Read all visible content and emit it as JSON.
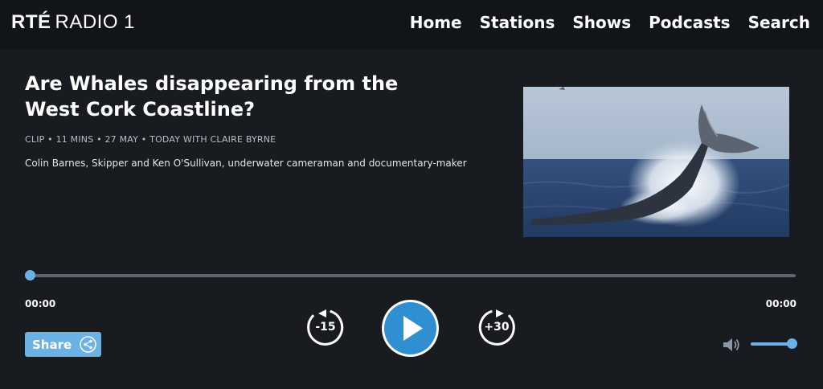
{
  "header": {
    "logo_brand": "RTÉ",
    "logo_station": "RADIO 1",
    "nav": [
      {
        "label": "Home"
      },
      {
        "label": "Stations"
      },
      {
        "label": "Shows"
      },
      {
        "label": "Podcasts"
      },
      {
        "label": "Search"
      }
    ]
  },
  "episode": {
    "title": "Are Whales disappearing from the West Cork Coastline?",
    "meta": "CLIP • 11 MINS • 27 MAY • TODAY WITH CLAIRE BYRNE",
    "description": "Colin Barnes, Skipper and Ken O'Sullivan, underwater cameraman and documentary-maker",
    "image_subject": "humpback whale tail breaching from sea"
  },
  "player": {
    "progress": 0,
    "elapsed": "00:00",
    "duration": "00:00",
    "skip_back_label": "-15",
    "skip_forward_label": "+30",
    "play_icon": "play-icon",
    "share_label": "Share",
    "share_icon": "share-icon",
    "volume_icon": "speaker-icon",
    "volume_level": 1.0
  },
  "colors": {
    "accent": "#6ab1e6",
    "play_button": "#2f8fd0",
    "background": "#181c21",
    "header_background": "#121518"
  }
}
